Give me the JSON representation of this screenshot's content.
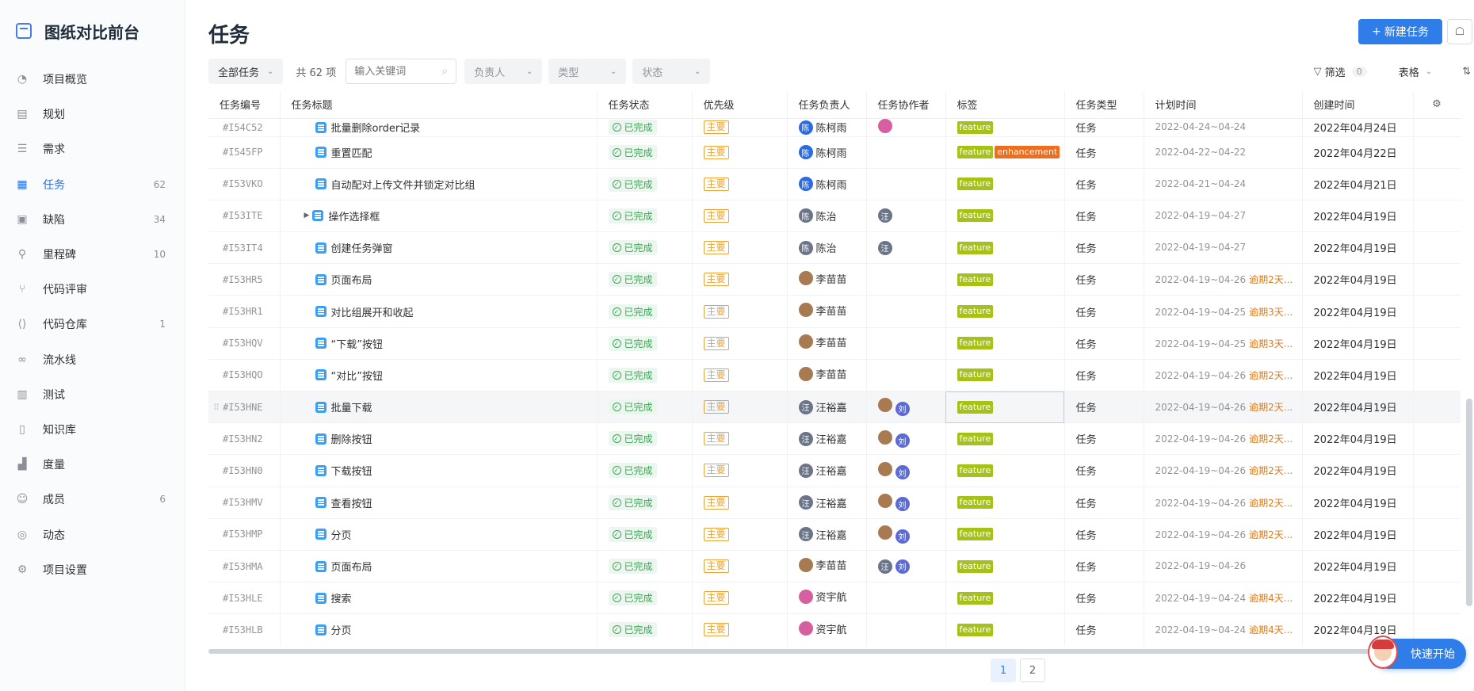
{
  "app": {
    "title": "图纸对比前台"
  },
  "sidebar": {
    "items": [
      {
        "icon": "dashboard-icon",
        "glyph": "◔",
        "label": "项目概览",
        "count": ""
      },
      {
        "icon": "plan-icon",
        "glyph": "▤",
        "label": "规划",
        "count": ""
      },
      {
        "icon": "requirement-icon",
        "glyph": "☰",
        "label": "需求",
        "count": ""
      },
      {
        "icon": "task-icon",
        "glyph": "▦",
        "label": "任务",
        "count": "62",
        "active": true
      },
      {
        "icon": "bug-icon",
        "glyph": "▣",
        "label": "缺陷",
        "count": "34"
      },
      {
        "icon": "milestone-icon",
        "glyph": "⚲",
        "label": "里程碑",
        "count": "10"
      },
      {
        "icon": "code-review-icon",
        "glyph": "⑂",
        "label": "代码评审",
        "count": ""
      },
      {
        "icon": "repo-icon",
        "glyph": "⟨⟩",
        "label": "代码仓库",
        "count": "1"
      },
      {
        "icon": "pipeline-icon",
        "glyph": "∞",
        "label": "流水线",
        "count": ""
      },
      {
        "icon": "test-icon",
        "glyph": "▥",
        "label": "测试",
        "count": ""
      },
      {
        "icon": "wiki-icon",
        "glyph": "▯",
        "label": "知识库",
        "count": ""
      },
      {
        "icon": "metrics-icon",
        "glyph": "▟",
        "label": "度量",
        "count": ""
      },
      {
        "icon": "members-icon",
        "glyph": "☺",
        "label": "成员",
        "count": "6"
      },
      {
        "icon": "activity-icon",
        "glyph": "◎",
        "label": "动态",
        "count": ""
      },
      {
        "icon": "settings-icon",
        "glyph": "⚙",
        "label": "项目设置",
        "count": ""
      }
    ]
  },
  "header": {
    "title": "任务",
    "new_button": "新建任务",
    "new_icon": "+",
    "robot_glyph": "☖"
  },
  "toolbar": {
    "scope": "全部任务",
    "count_text": "共 62 项",
    "search_placeholder": "输入关键词",
    "assignee": "负责人",
    "type": "类型",
    "status": "状态",
    "filter_label": "筛选",
    "filter_count": "0",
    "view_label": "表格",
    "sort_glyph": "⇅"
  },
  "table": {
    "columns": [
      "任务编号",
      "任务标题",
      "任务状态",
      "优先级",
      "任务负责人",
      "任务协作者",
      "标签",
      "任务类型",
      "计划时间",
      "创建时间"
    ],
    "settings_glyph": "⚙",
    "rows": [
      {
        "id": "#I54C52",
        "title": "批量删除order记录",
        "status": "已完成",
        "priority": "主要",
        "owner": "陈柯雨",
        "owner_av": "陈",
        "owner_color": "blue",
        "collab": [
          {
            "t": "",
            "c": "pink"
          }
        ],
        "tags": [
          "feature"
        ],
        "type": "任务",
        "plan": "2022-04-24~04-24",
        "overdue": "",
        "created": "2022年04月24日",
        "partial": true
      },
      {
        "id": "#I545FP",
        "title": "重置匹配",
        "status": "已完成",
        "priority": "主要",
        "owner": "陈柯雨",
        "owner_av": "陈",
        "owner_color": "blue",
        "collab": [],
        "tags": [
          "feature",
          "enhancement"
        ],
        "type": "任务",
        "plan": "2022-04-22~04-22",
        "overdue": "",
        "created": "2022年04月22日"
      },
      {
        "id": "#I53VKO",
        "title": "自动配对上传文件并锁定对比组",
        "status": "已完成",
        "priority": "主要",
        "owner": "陈柯雨",
        "owner_av": "陈",
        "owner_color": "blue",
        "collab": [],
        "tags": [
          "feature"
        ],
        "type": "任务",
        "plan": "2022-04-21~04-24",
        "overdue": "",
        "created": "2022年04月21日"
      },
      {
        "id": "#I53ITE",
        "title": "操作选择框",
        "status": "已完成",
        "priority": "主要",
        "owner": "陈治",
        "owner_av": "陈",
        "owner_color": "gray",
        "collab": [
          {
            "t": "汪",
            "c": "gray"
          }
        ],
        "tags": [
          "feature"
        ],
        "type": "任务",
        "plan": "2022-04-19~04-27",
        "overdue": "",
        "created": "2022年04月19日",
        "expand": true
      },
      {
        "id": "#I53IT4",
        "title": "创建任务弹窗",
        "status": "已完成",
        "priority": "主要",
        "owner": "陈治",
        "owner_av": "陈",
        "owner_color": "gray",
        "collab": [
          {
            "t": "汪",
            "c": "gray"
          }
        ],
        "tags": [
          "feature"
        ],
        "type": "任务",
        "plan": "2022-04-19~04-27",
        "overdue": "",
        "created": "2022年04月19日"
      },
      {
        "id": "#I53HR5",
        "title": "页面布局",
        "status": "已完成",
        "priority": "主要",
        "owner": "李苗苗",
        "owner_av": "",
        "owner_color": "brown",
        "collab": [],
        "tags": [
          "feature"
        ],
        "type": "任务",
        "plan": "2022-04-19~04-26",
        "overdue": "逾期2天...",
        "created": "2022年04月19日"
      },
      {
        "id": "#I53HR1",
        "title": "对比组展开和收起",
        "status": "已完成",
        "priority": "主要",
        "owner": "李苗苗",
        "owner_av": "",
        "owner_color": "brown",
        "collab": [],
        "tags": [
          "feature"
        ],
        "type": "任务",
        "plan": "2022-04-19~04-25",
        "overdue": "逾期3天...",
        "created": "2022年04月19日"
      },
      {
        "id": "#I53HQV",
        "title": "“下载”按钮",
        "status": "已完成",
        "priority": "主要",
        "owner": "李苗苗",
        "owner_av": "",
        "owner_color": "brown",
        "collab": [],
        "tags": [
          "feature"
        ],
        "type": "任务",
        "plan": "2022-04-19~04-25",
        "overdue": "逾期3天...",
        "created": "2022年04月19日"
      },
      {
        "id": "#I53HQO",
        "title": "“对比”按钮",
        "status": "已完成",
        "priority": "主要",
        "owner": "李苗苗",
        "owner_av": "",
        "owner_color": "brown",
        "collab": [],
        "tags": [
          "feature"
        ],
        "type": "任务",
        "plan": "2022-04-19~04-26",
        "overdue": "逾期2天...",
        "created": "2022年04月19日"
      },
      {
        "id": "#I53HNE",
        "title": "批量下载",
        "status": "已完成",
        "priority": "主要",
        "owner": "汪裕嘉",
        "owner_av": "汪",
        "owner_color": "gray",
        "collab": [
          {
            "t": "",
            "c": "brown"
          },
          {
            "t": "刘",
            "c": "purple"
          }
        ],
        "tags": [
          "feature"
        ],
        "type": "任务",
        "plan": "2022-04-19~04-26",
        "overdue": "逾期2天...",
        "created": "2022年04月19日",
        "highlight": true
      },
      {
        "id": "#I53HN2",
        "title": "删除按钮",
        "status": "已完成",
        "priority": "主要",
        "owner": "汪裕嘉",
        "owner_av": "汪",
        "owner_color": "gray",
        "collab": [
          {
            "t": "",
            "c": "brown"
          },
          {
            "t": "刘",
            "c": "purple"
          }
        ],
        "tags": [
          "feature"
        ],
        "type": "任务",
        "plan": "2022-04-19~04-26",
        "overdue": "逾期2天...",
        "created": "2022年04月19日"
      },
      {
        "id": "#I53HN0",
        "title": "下载按钮",
        "status": "已完成",
        "priority": "主要",
        "owner": "汪裕嘉",
        "owner_av": "汪",
        "owner_color": "gray",
        "collab": [
          {
            "t": "",
            "c": "brown"
          },
          {
            "t": "刘",
            "c": "purple"
          }
        ],
        "tags": [
          "feature"
        ],
        "type": "任务",
        "plan": "2022-04-19~04-26",
        "overdue": "逾期2天...",
        "created": "2022年04月19日"
      },
      {
        "id": "#I53HMV",
        "title": "查看按钮",
        "status": "已完成",
        "priority": "主要",
        "owner": "汪裕嘉",
        "owner_av": "汪",
        "owner_color": "gray",
        "collab": [
          {
            "t": "",
            "c": "brown"
          },
          {
            "t": "刘",
            "c": "purple"
          }
        ],
        "tags": [
          "feature"
        ],
        "type": "任务",
        "plan": "2022-04-19~04-26",
        "overdue": "逾期2天...",
        "created": "2022年04月19日"
      },
      {
        "id": "#I53HMP",
        "title": "分页",
        "status": "已完成",
        "priority": "主要",
        "owner": "汪裕嘉",
        "owner_av": "汪",
        "owner_color": "gray",
        "collab": [
          {
            "t": "",
            "c": "brown"
          },
          {
            "t": "刘",
            "c": "purple"
          }
        ],
        "tags": [
          "feature"
        ],
        "type": "任务",
        "plan": "2022-04-19~04-26",
        "overdue": "逾期2天...",
        "created": "2022年04月19日"
      },
      {
        "id": "#I53HMA",
        "title": "页面布局",
        "status": "已完成",
        "priority": "主要",
        "owner": "李苗苗",
        "owner_av": "",
        "owner_color": "brown",
        "collab": [
          {
            "t": "汪",
            "c": "gray"
          },
          {
            "t": "刘",
            "c": "purple"
          }
        ],
        "tags": [
          "feature"
        ],
        "type": "任务",
        "plan": "2022-04-19~04-26",
        "overdue": "",
        "created": "2022年04月19日"
      },
      {
        "id": "#I53HLE",
        "title": "搜索",
        "status": "已完成",
        "priority": "主要",
        "owner": "资宇航",
        "owner_av": "",
        "owner_color": "pink",
        "collab": [],
        "tags": [
          "feature"
        ],
        "type": "任务",
        "plan": "2022-04-19~04-24",
        "overdue": "逾期4天...",
        "created": "2022年04月19日"
      },
      {
        "id": "#I53HLB",
        "title": "分页",
        "status": "已完成",
        "priority": "主要",
        "owner": "资宇航",
        "owner_av": "",
        "owner_color": "pink",
        "collab": [],
        "tags": [
          "feature"
        ],
        "type": "任务",
        "plan": "2022-04-19~04-24",
        "overdue": "逾期4天...",
        "created": "2022年04月19日"
      }
    ]
  },
  "pagination": {
    "pages": [
      "1",
      "2"
    ],
    "current": "1"
  },
  "quick_start": {
    "label": "快速开始"
  },
  "colors": {
    "accent": "#2e7de8",
    "feature_tag": "#a6c21a",
    "enhancement_tag": "#ef6e1e",
    "done_status": "#3ca556",
    "priority": "#e8a33c",
    "overdue": "#e07b16"
  }
}
